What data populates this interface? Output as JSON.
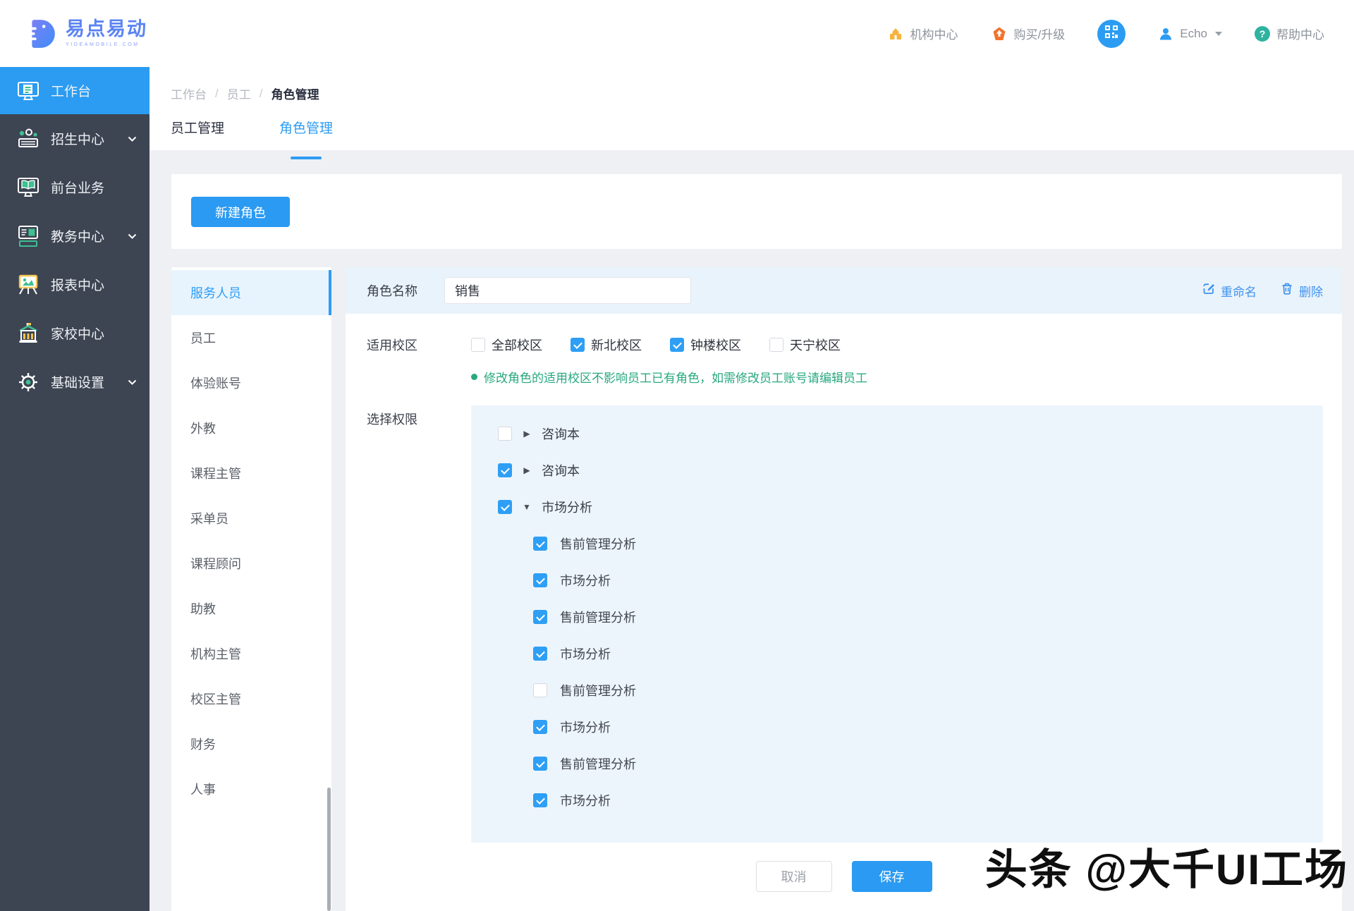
{
  "header": {
    "logo_name": "易点易动",
    "logo_tagline": "YIDEAMOBILE.COM",
    "nav": {
      "org_center": "机构中心",
      "buy_upgrade": "购买/升级",
      "username": "Echo",
      "help_center": "帮助中心"
    }
  },
  "sidebar": {
    "items": [
      {
        "label": "工作台",
        "active": true,
        "expandable": false
      },
      {
        "label": "招生中心",
        "active": false,
        "expandable": true
      },
      {
        "label": "前台业务",
        "active": false,
        "expandable": false
      },
      {
        "label": "教务中心",
        "active": false,
        "expandable": true
      },
      {
        "label": "报表中心",
        "active": false,
        "expandable": false
      },
      {
        "label": "家校中心",
        "active": false,
        "expandable": false
      },
      {
        "label": "基础设置",
        "active": false,
        "expandable": true
      }
    ]
  },
  "breadcrumb": {
    "items": [
      "工作台",
      "员工",
      "角色管理"
    ],
    "separator": "/"
  },
  "tabs": [
    {
      "label": "员工管理",
      "active": false
    },
    {
      "label": "角色管理",
      "active": true
    }
  ],
  "toolbar": {
    "new_role_label": "新建角色"
  },
  "role_list": {
    "items": [
      {
        "label": "服务人员",
        "active": true
      },
      {
        "label": "员工",
        "active": false
      },
      {
        "label": "体验账号",
        "active": false
      },
      {
        "label": "外教",
        "active": false
      },
      {
        "label": "课程主管",
        "active": false
      },
      {
        "label": "采单员",
        "active": false
      },
      {
        "label": "课程顾问",
        "active": false
      },
      {
        "label": "助教",
        "active": false
      },
      {
        "label": "机构主管",
        "active": false
      },
      {
        "label": "校区主管",
        "active": false
      },
      {
        "label": "财务",
        "active": false
      },
      {
        "label": "人事",
        "active": false
      }
    ]
  },
  "detail": {
    "name_label": "角色名称",
    "name_value": "销售",
    "rename_label": "重命名",
    "delete_label": "删除",
    "campus_label": "适用校区",
    "campuses": [
      {
        "label": "全部校区",
        "checked": false
      },
      {
        "label": "新北校区",
        "checked": true
      },
      {
        "label": "钟楼校区",
        "checked": true
      },
      {
        "label": "天宁校区",
        "checked": false
      }
    ],
    "hint": "修改角色的适用校区不影响员工已有角色，如需修改员工账号请编辑员工",
    "perm_label": "选择权限",
    "tree": [
      {
        "label": "咨询本",
        "checked": false,
        "expanded": false
      },
      {
        "label": "咨询本",
        "checked": true,
        "expanded": false
      },
      {
        "label": "市场分析",
        "checked": true,
        "expanded": true,
        "children": [
          {
            "label": "售前管理分析",
            "checked": true
          },
          {
            "label": "市场分析",
            "checked": true
          },
          {
            "label": "售前管理分析",
            "checked": true
          },
          {
            "label": "市场分析",
            "checked": true
          },
          {
            "label": "售前管理分析",
            "checked": false
          },
          {
            "label": "市场分析",
            "checked": true
          },
          {
            "label": "售前管理分析",
            "checked": true
          },
          {
            "label": "市场分析",
            "checked": true
          }
        ]
      }
    ],
    "cancel_label": "取消",
    "save_label": "保存"
  },
  "watermark": "头条 @大千UI工场",
  "icons": {
    "caret_right": "▶",
    "caret_down": "▼",
    "question": "?"
  },
  "colors": {
    "primary": "#2e9cf4",
    "sidebar_bg": "#3d4452",
    "panel_blue": "#e9f3fb",
    "tree_blue": "#edf5fc",
    "hint_green": "#27a87f",
    "warn_orange": "#f4722c",
    "brand_yellow": "#f6b43e",
    "help_teal": "#2fb3a0"
  }
}
